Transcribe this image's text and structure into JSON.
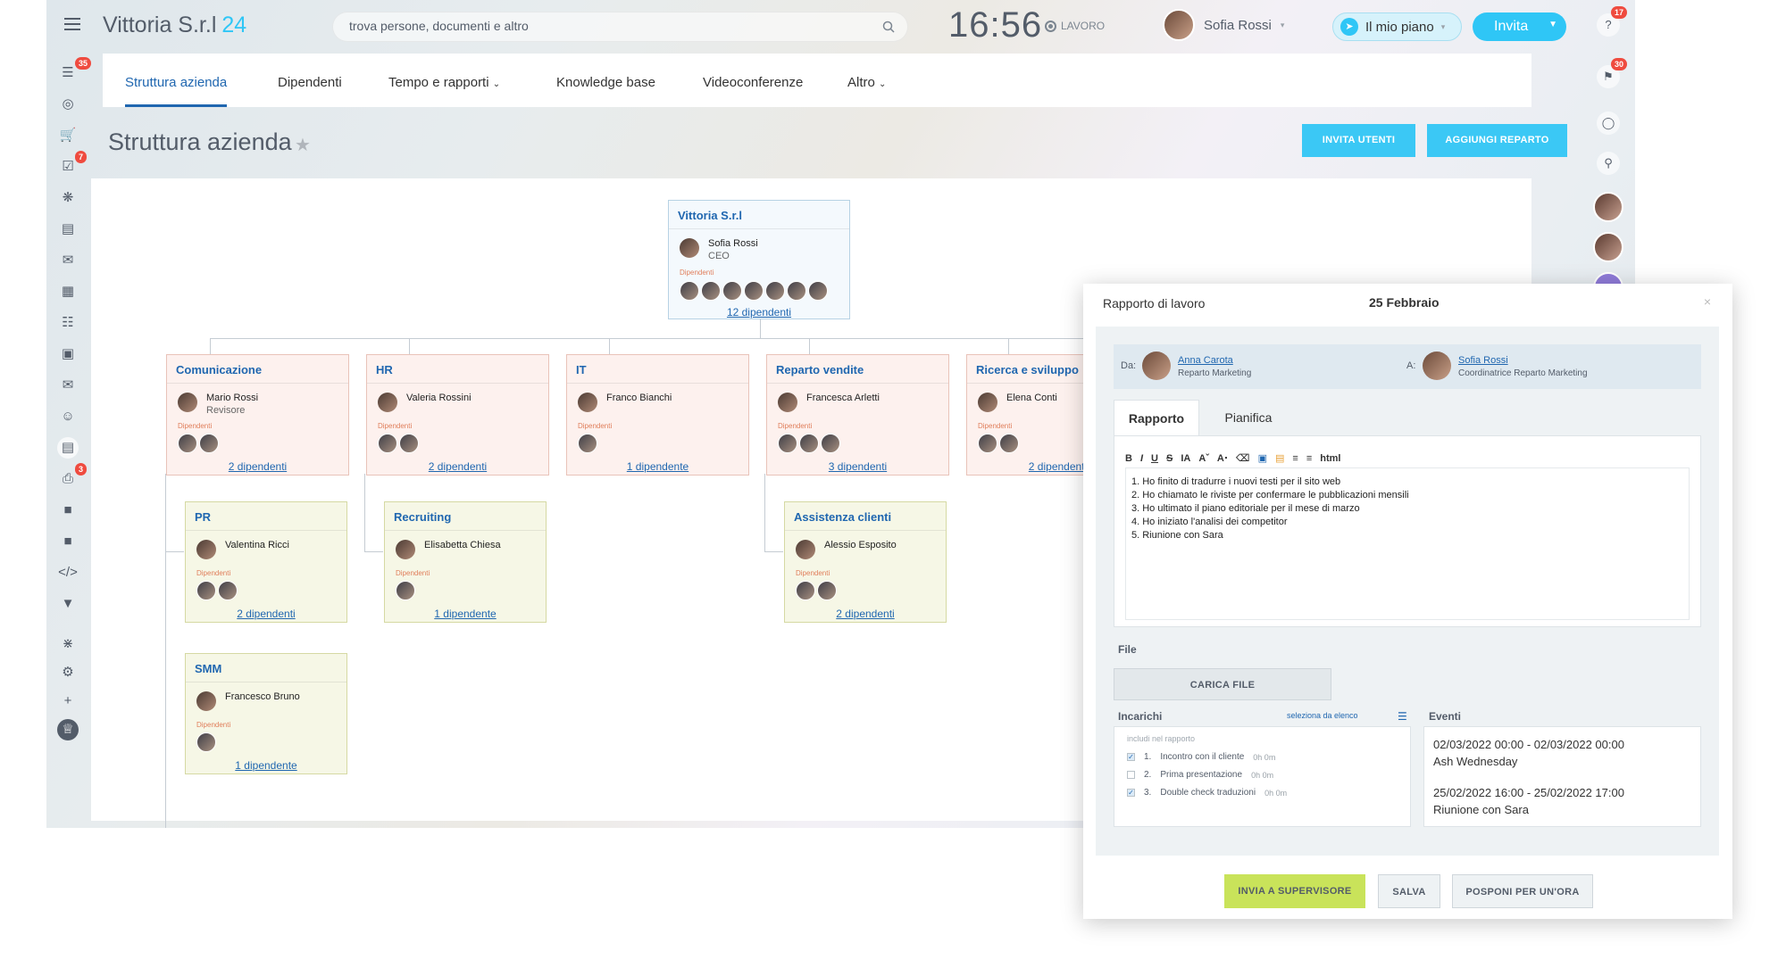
{
  "header": {
    "brand_name": "Vittoria S.r.l",
    "brand_num": "24",
    "search_placeholder": "trova persone, documenti e altro",
    "clock": "16:56",
    "work_status": "LAVORO",
    "user_name": "Sofia Rossi",
    "plan_label": "Il mio piano",
    "invite_label": "Invita"
  },
  "left_sidebar": {
    "badges": [
      "35",
      "7",
      "3"
    ]
  },
  "nav": {
    "tabs": [
      "Struttura azienda",
      "Dipendenti",
      "Tempo e rapporti",
      "Knowledge base",
      "Videoconferenze",
      "Altro"
    ]
  },
  "page": {
    "title": "Struttura azienda",
    "btn_invite_users": "INVITA UTENTI",
    "btn_add_dept": "AGGIUNGI REPARTO"
  },
  "org": {
    "deps_label": "Dipendenti",
    "root": {
      "name": "Vittoria S.r.l",
      "person": "Sofia Rossi",
      "role": "CEO",
      "count": "12 dipendenti"
    },
    "departments": [
      {
        "name": "Comunicazione",
        "person": "Mario Rossi",
        "role": "Revisore",
        "count": "2 dipendenti"
      },
      {
        "name": "HR",
        "person": "Valeria Rossini",
        "role": "",
        "count": "2 dipendenti"
      },
      {
        "name": "IT",
        "person": "Franco Bianchi",
        "role": "",
        "count": "1 dipendente"
      },
      {
        "name": "Reparto vendite",
        "person": "Francesca Arletti",
        "role": "",
        "count": "3 dipendenti"
      },
      {
        "name": "Ricerca e sviluppo",
        "person": "Elena Conti",
        "role": "",
        "count": "2 dipendenti"
      }
    ],
    "subdepartments": [
      {
        "name": "PR",
        "person": "Valentina Ricci",
        "count": "2 dipendenti"
      },
      {
        "name": "Recruiting",
        "person": "Elisabetta Chiesa",
        "count": "1 dipendente"
      },
      {
        "name": "Assistenza clienti",
        "person": "Alessio Esposito",
        "count": "2 dipendenti"
      },
      {
        "name": "SMM",
        "person": "Francesco Bruno",
        "count": "1 dipendente"
      }
    ]
  },
  "right_sidebar": {
    "badges": [
      "17",
      "30"
    ]
  },
  "report": {
    "title": "Rapporto di lavoro",
    "date": "25 Febbraio",
    "from_label": "Da:",
    "from_name": "Anna Carota",
    "from_role": "Reparto Marketing",
    "to_label": "A:",
    "to_name": "Sofia Rossi",
    "to_role": "Coordinatrice Reparto Marketing",
    "tab_report": "Rapporto",
    "tab_plan": "Pianifica",
    "toolbar_html": "html",
    "lines": [
      "1. Ho finito di tradurre i nuovi testi per il sito web",
      "2. Ho chiamato le riviste per confermare le pubblicazioni mensili",
      "3. Ho ultimato il piano editoriale per il mese di marzo",
      "4. Ho iniziato l'analisi dei competitor",
      "5. Riunione con Sara"
    ],
    "file_label": "File",
    "upload_label": "CARICA FILE",
    "tasks_label": "Incarichi",
    "tasks_select": "seleziona da elenco",
    "events_label": "Eventi",
    "tasks_placeholder": "includi nel rapporto",
    "tasks": [
      {
        "num": "1.",
        "text": "Incontro con il cliente",
        "hours": "0h 0m",
        "checked": true
      },
      {
        "num": "2.",
        "text": "Prima presentazione",
        "hours": "0h 0m",
        "checked": false
      },
      {
        "num": "3.",
        "text": "Double check traduzioni",
        "hours": "0h 0m",
        "checked": true
      }
    ],
    "events": [
      {
        "time": "02/03/2022 00:00 - 02/03/2022 00:00",
        "title": "Ash Wednesday"
      },
      {
        "time": "25/02/2022 16:00 - 25/02/2022 17:00",
        "title": "Riunione con Sara"
      }
    ],
    "btn_send": "INVIA A SUPERVISORE",
    "btn_save": "SALVA",
    "btn_postpone": "POSPONI PER UN'ORA"
  },
  "colors": {
    "accent_blue": "#2fc6f6",
    "link_blue": "#2067b0",
    "send_button": "#c9e35a",
    "badge_red": "#ef4b3f"
  }
}
